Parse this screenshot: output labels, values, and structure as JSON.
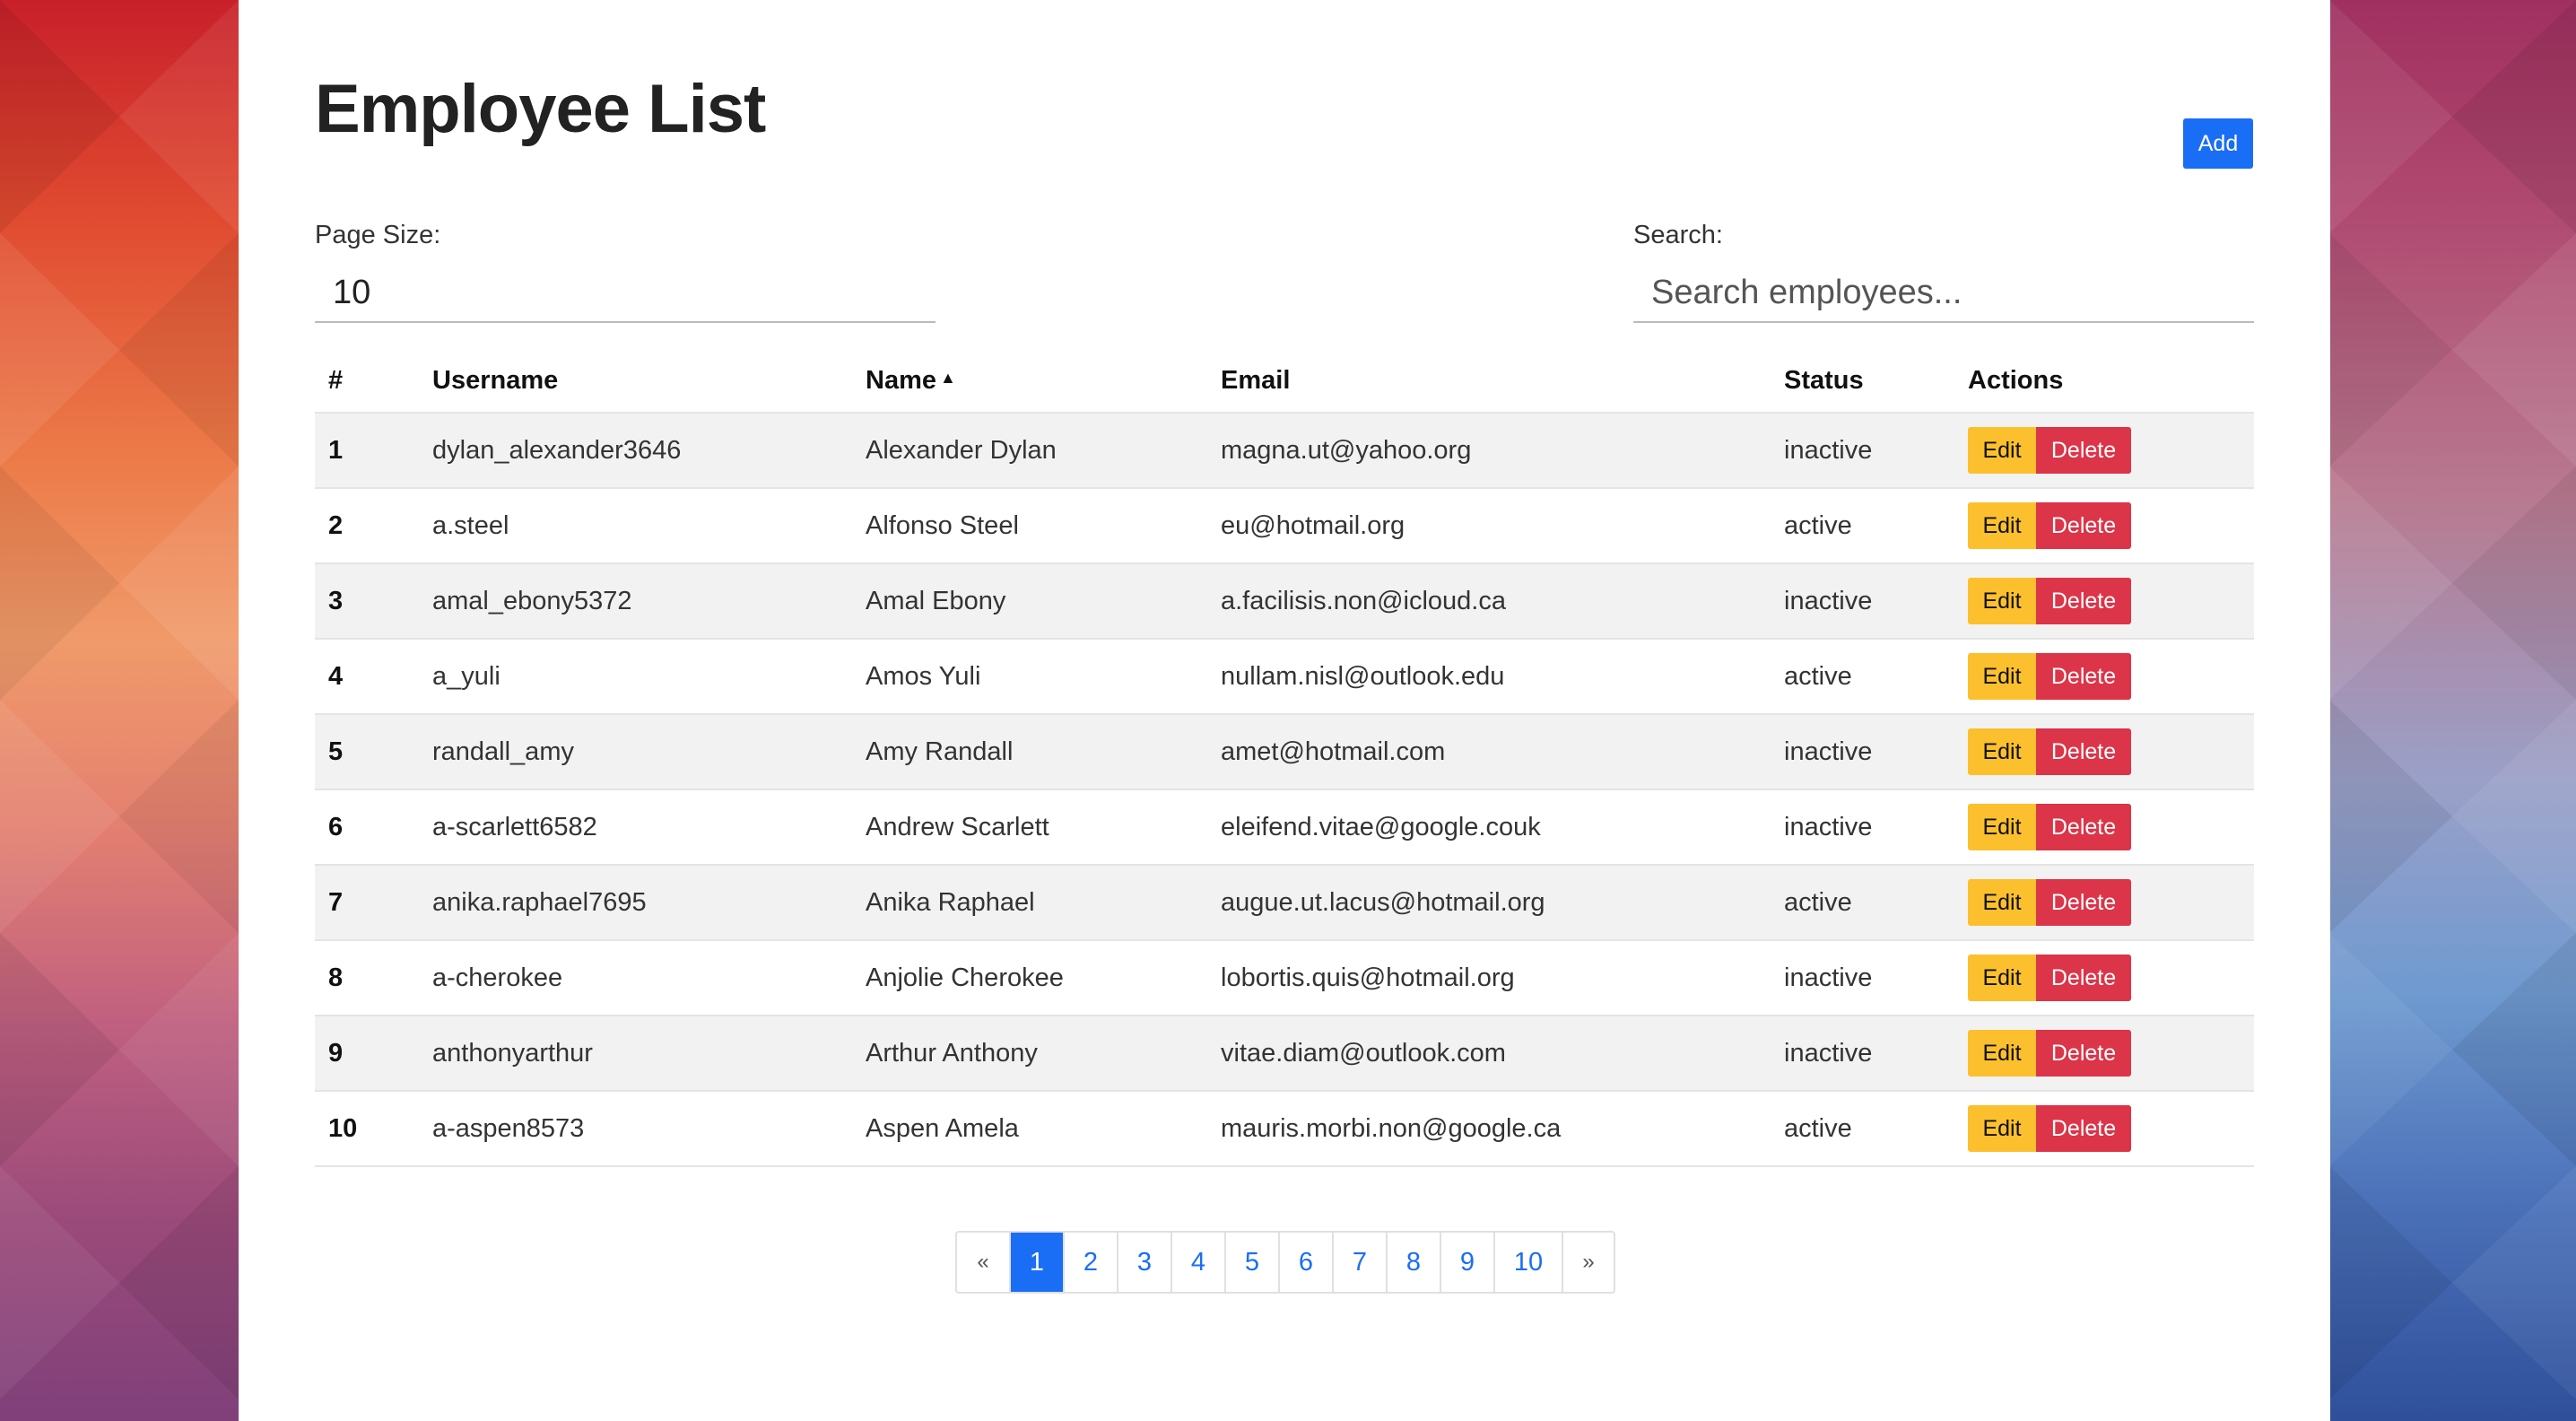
{
  "page": {
    "title": "Employee List",
    "add_label": "Add"
  },
  "controls": {
    "page_size_label": "Page Size:",
    "page_size_value": "10",
    "search_label": "Search:",
    "search_placeholder": "Search employees..."
  },
  "table": {
    "headers": {
      "num": "#",
      "username": "Username",
      "name": "Name",
      "email": "Email",
      "status": "Status",
      "actions": "Actions"
    },
    "sort_icon": "caret-up-icon",
    "edit_label": "Edit",
    "delete_label": "Delete",
    "rows": [
      {
        "num": "1",
        "username": "dylan_alexander3646",
        "name": "Alexander Dylan",
        "email": "magna.ut@yahoo.org",
        "status": "inactive"
      },
      {
        "num": "2",
        "username": "a.steel",
        "name": "Alfonso Steel",
        "email": "eu@hotmail.org",
        "status": "active"
      },
      {
        "num": "3",
        "username": "amal_ebony5372",
        "name": "Amal Ebony",
        "email": "a.facilisis.non@icloud.ca",
        "status": "inactive"
      },
      {
        "num": "4",
        "username": "a_yuli",
        "name": "Amos Yuli",
        "email": "nullam.nisl@outlook.edu",
        "status": "active"
      },
      {
        "num": "5",
        "username": "randall_amy",
        "name": "Amy Randall",
        "email": "amet@hotmail.com",
        "status": "inactive"
      },
      {
        "num": "6",
        "username": "a-scarlett6582",
        "name": "Andrew Scarlett",
        "email": "eleifend.vitae@google.couk",
        "status": "inactive"
      },
      {
        "num": "7",
        "username": "anika.raphael7695",
        "name": "Anika Raphael",
        "email": "augue.ut.lacus@hotmail.org",
        "status": "active"
      },
      {
        "num": "8",
        "username": "a-cherokee",
        "name": "Anjolie Cherokee",
        "email": "lobortis.quis@hotmail.org",
        "status": "inactive"
      },
      {
        "num": "9",
        "username": "anthonyarthur",
        "name": "Arthur Anthony",
        "email": "vitae.diam@outlook.com",
        "status": "inactive"
      },
      {
        "num": "10",
        "username": "a-aspen8573",
        "name": "Aspen Amela",
        "email": "mauris.morbi.non@google.ca",
        "status": "active"
      }
    ]
  },
  "pagination": {
    "prev": "«",
    "next": "»",
    "pages": [
      "1",
      "2",
      "3",
      "4",
      "5",
      "6",
      "7",
      "8",
      "9",
      "10"
    ],
    "active": "1"
  },
  "colors": {
    "primary": "#1a6ef5",
    "warning": "#fcc02e",
    "danger": "#dc3448"
  }
}
